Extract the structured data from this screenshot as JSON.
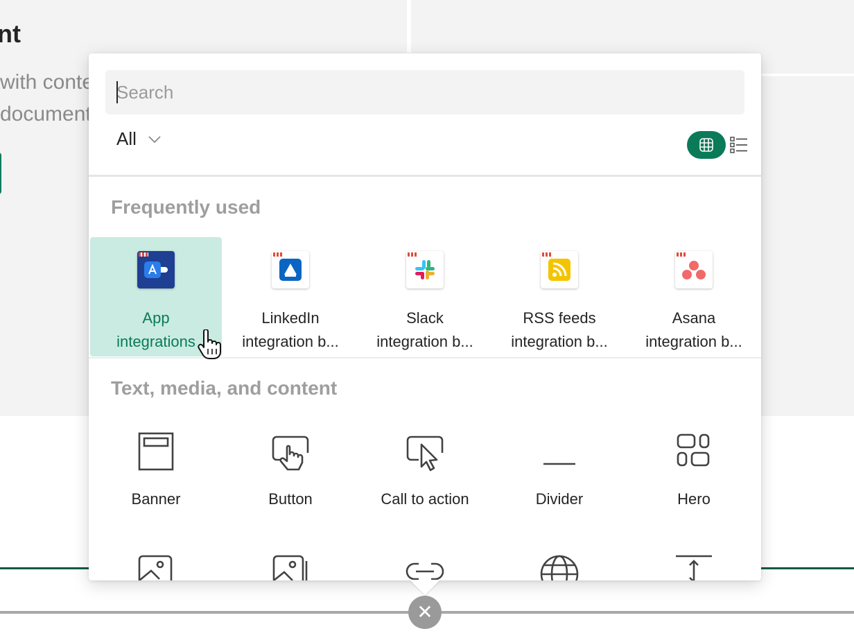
{
  "background": {
    "title_fragment": "nt",
    "desc_line1": "with conte",
    "desc_line2": "document"
  },
  "picker": {
    "search": {
      "placeholder": "Search",
      "value": ""
    },
    "filter": {
      "selected": "All"
    },
    "view_toggle": {
      "active": "grid"
    },
    "sections": {
      "frequently_used": {
        "title": "Frequently used",
        "items": [
          {
            "line1": "App",
            "line2": "integrations",
            "icon": "app-integrations-icon",
            "color": "#1f3f93",
            "selected": true
          },
          {
            "line1": "LinkedIn",
            "line2": "integration b...",
            "icon": "linkedin-icon",
            "color": "#0a66c2"
          },
          {
            "line1": "Slack",
            "line2": "integration b...",
            "icon": "slack-icon",
            "color": "#ffffff"
          },
          {
            "line1": "RSS feeds",
            "line2": "integration b...",
            "icon": "rss-icon",
            "color": "#f4c400"
          },
          {
            "line1": "Asana",
            "line2": "integration b...",
            "icon": "asana-icon",
            "color": "#f06a6a"
          }
        ]
      },
      "text_media": {
        "title": "Text, media, and content",
        "items": [
          {
            "label": "Banner",
            "icon": "banner-icon"
          },
          {
            "label": "Button",
            "icon": "button-icon"
          },
          {
            "label": "Call to action",
            "icon": "call-to-action-icon"
          },
          {
            "label": "Divider",
            "icon": "divider-icon"
          },
          {
            "label": "Hero",
            "icon": "hero-icon"
          }
        ],
        "partial_icons": [
          "image-icon",
          "image-gallery-icon",
          "link-icon",
          "globe-icon",
          "spacer-icon"
        ]
      }
    }
  },
  "colors": {
    "accent": "#0b7a58",
    "selected_tile_bg": "#c9ebe1",
    "section_title": "#9e9e9e",
    "page_bg": "#f3f3f3"
  }
}
